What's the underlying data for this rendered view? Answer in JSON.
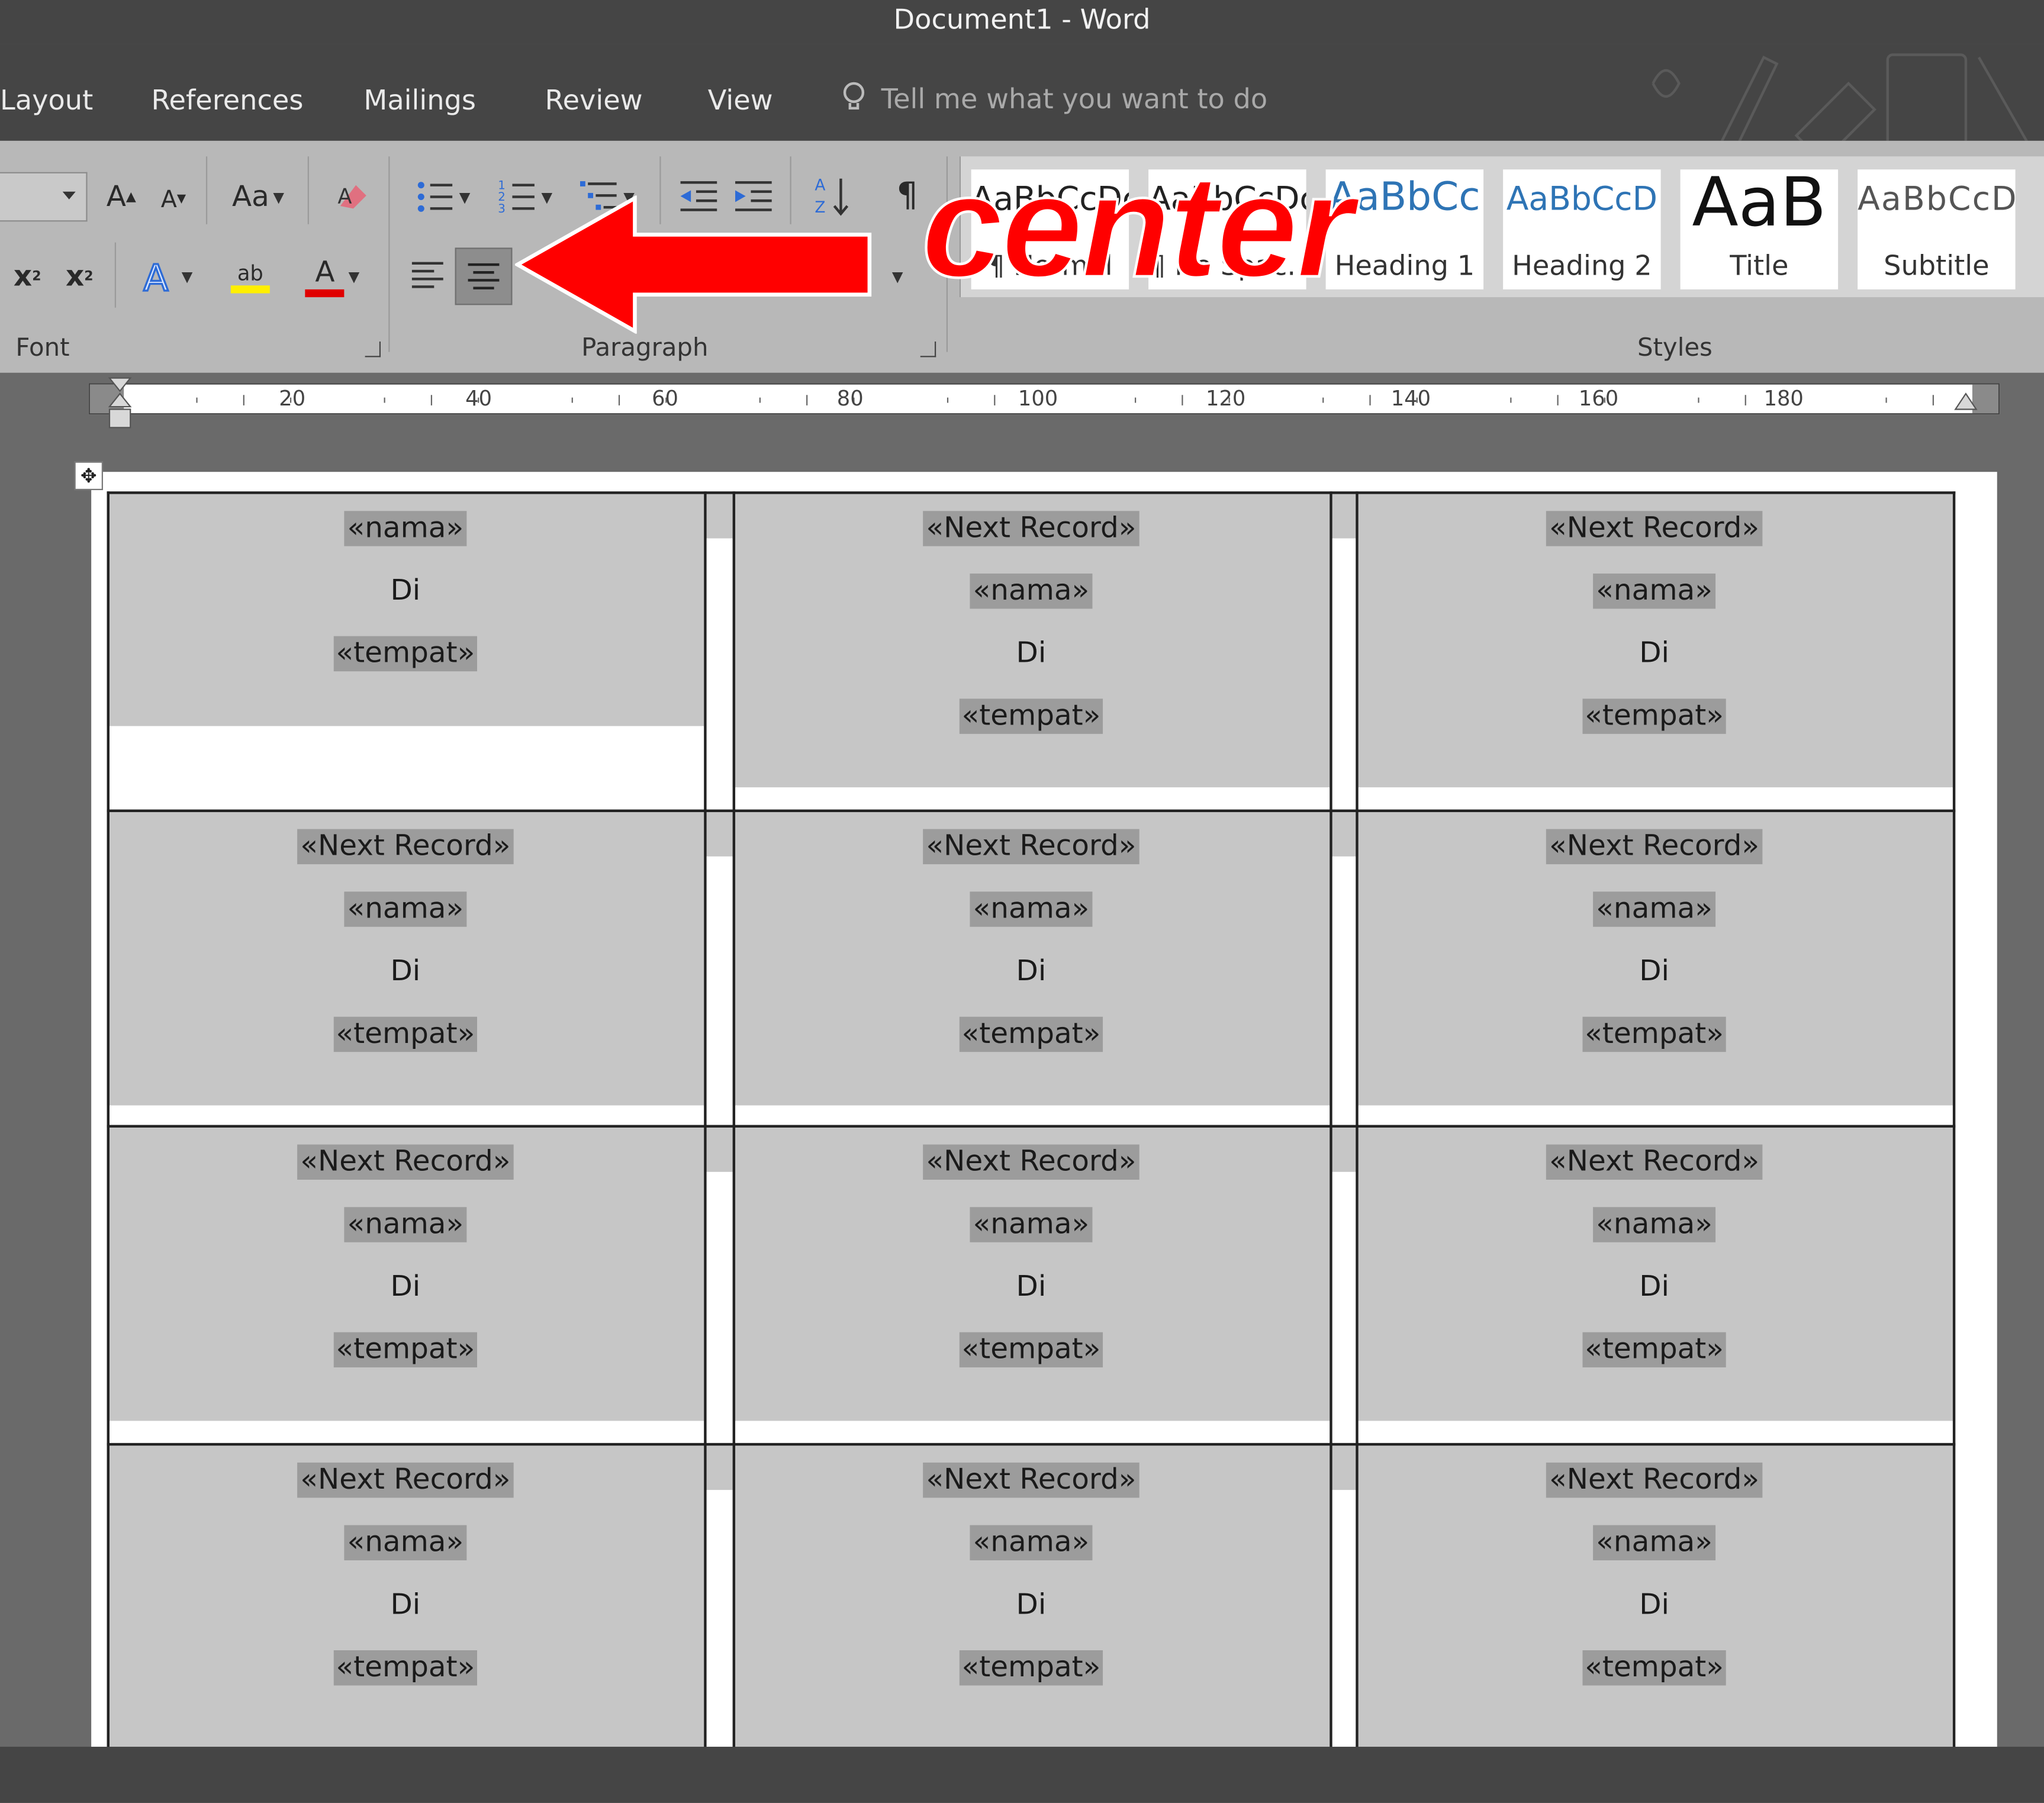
{
  "window": {
    "title": "Document1  -  Word"
  },
  "tabs": [
    "Layout",
    "References",
    "Mailings",
    "Review",
    "View"
  ],
  "tell_me": {
    "placeholder": "Tell me what you want to do"
  },
  "ribbon": {
    "groups": {
      "font": "Font",
      "paragraph": "Paragraph",
      "styles": "Styles"
    },
    "font_buttons": {
      "grow": "A",
      "shrink": "A",
      "change_case": "Aa",
      "subscript": "x",
      "superscript": "x",
      "highlight": "ab",
      "font_color": "A"
    },
    "paragraph_buttons": {
      "pilcrow": "¶"
    }
  },
  "styles": [
    {
      "preview": "AaBbCcDc",
      "name": "¶ Normal"
    },
    {
      "preview": "AaBbCcDc",
      "name": "¶ No Spac..."
    },
    {
      "preview": "AaBbCc",
      "name": "Heading 1"
    },
    {
      "preview": "AaBbCcD",
      "name": "Heading 2"
    },
    {
      "preview": "AaB",
      "name": "Title"
    },
    {
      "preview": "AaBbCcD",
      "name": "Subtitle"
    }
  ],
  "annotation": {
    "text": "center"
  },
  "ruler": {
    "labels": [
      "20",
      "40",
      "60",
      "80",
      "100",
      "120",
      "140",
      "160",
      "180"
    ]
  },
  "labels_table": {
    "rows": [
      [
        [
          "«nama»",
          "Di",
          "«tempat»"
        ],
        [
          "«Next Record»",
          "«nama»",
          "Di",
          "«tempat»"
        ],
        [
          "«Next Record»",
          "«nama»",
          "Di",
          "«tempat»"
        ]
      ],
      [
        [
          "«Next Record»",
          "«nama»",
          "Di",
          "«tempat»"
        ],
        [
          "«Next Record»",
          "«nama»",
          "Di",
          "«tempat»"
        ],
        [
          "«Next Record»",
          "«nama»",
          "Di",
          "«tempat»"
        ]
      ],
      [
        [
          "«Next Record»",
          "«nama»",
          "Di",
          "«tempat»"
        ],
        [
          "«Next Record»",
          "«nama»",
          "Di",
          "«tempat»"
        ],
        [
          "«Next Record»",
          "«nama»",
          "Di",
          "«tempat»"
        ]
      ],
      [
        [
          "«Next Record»",
          "«nama»",
          "Di",
          "«tempat»"
        ],
        [
          "«Next Record»",
          "«nama»",
          "Di",
          "«tempat»"
        ],
        [
          "«Next Record»",
          "«nama»",
          "Di",
          "«tempat»"
        ]
      ]
    ]
  },
  "colors": {
    "chrome": "#454545",
    "ribbon": "#b8b8b8",
    "field_shading": "#9c9c9c",
    "cell_shading": "#c6c6c6",
    "annotation": "#ff0000"
  }
}
